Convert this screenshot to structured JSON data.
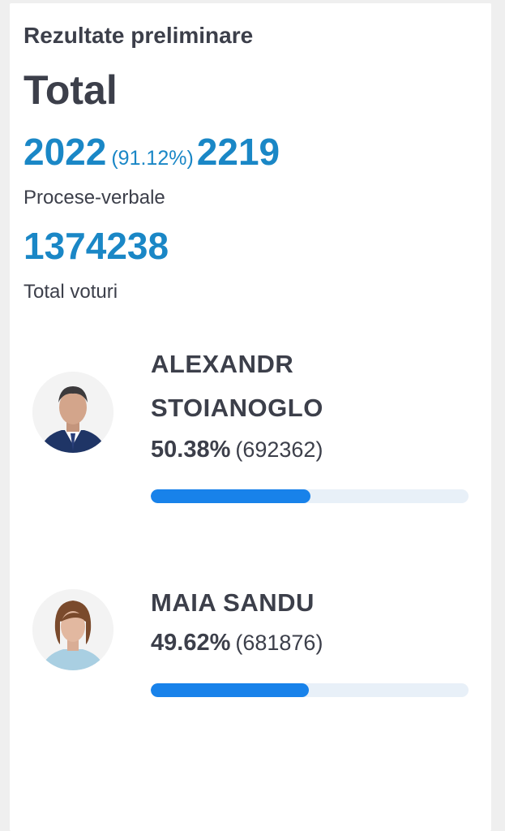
{
  "header": {
    "title": "Rezultate preliminare",
    "scope": "Total"
  },
  "protocols": {
    "processed": "2022",
    "percent": "(91.12%)",
    "total": "2219",
    "label": "Procese-verbale"
  },
  "votes": {
    "total": "1374238",
    "label": "Total voturi"
  },
  "candidates": [
    {
      "name_line1": "ALEXANDR",
      "name_line2": "STOIANOGLO",
      "percent": "50.38%",
      "votes": "(692362)",
      "share": 0.5038
    },
    {
      "name_line1": "MAIA SANDU",
      "percent": "49.62%",
      "votes": "(681876)",
      "share": 0.4962
    }
  ],
  "colors": {
    "accent_blue": "#1a87c6",
    "bar_fill": "#1882ea",
    "bar_track": "#e8f0f8",
    "text_dark": "#3c3f4a"
  }
}
